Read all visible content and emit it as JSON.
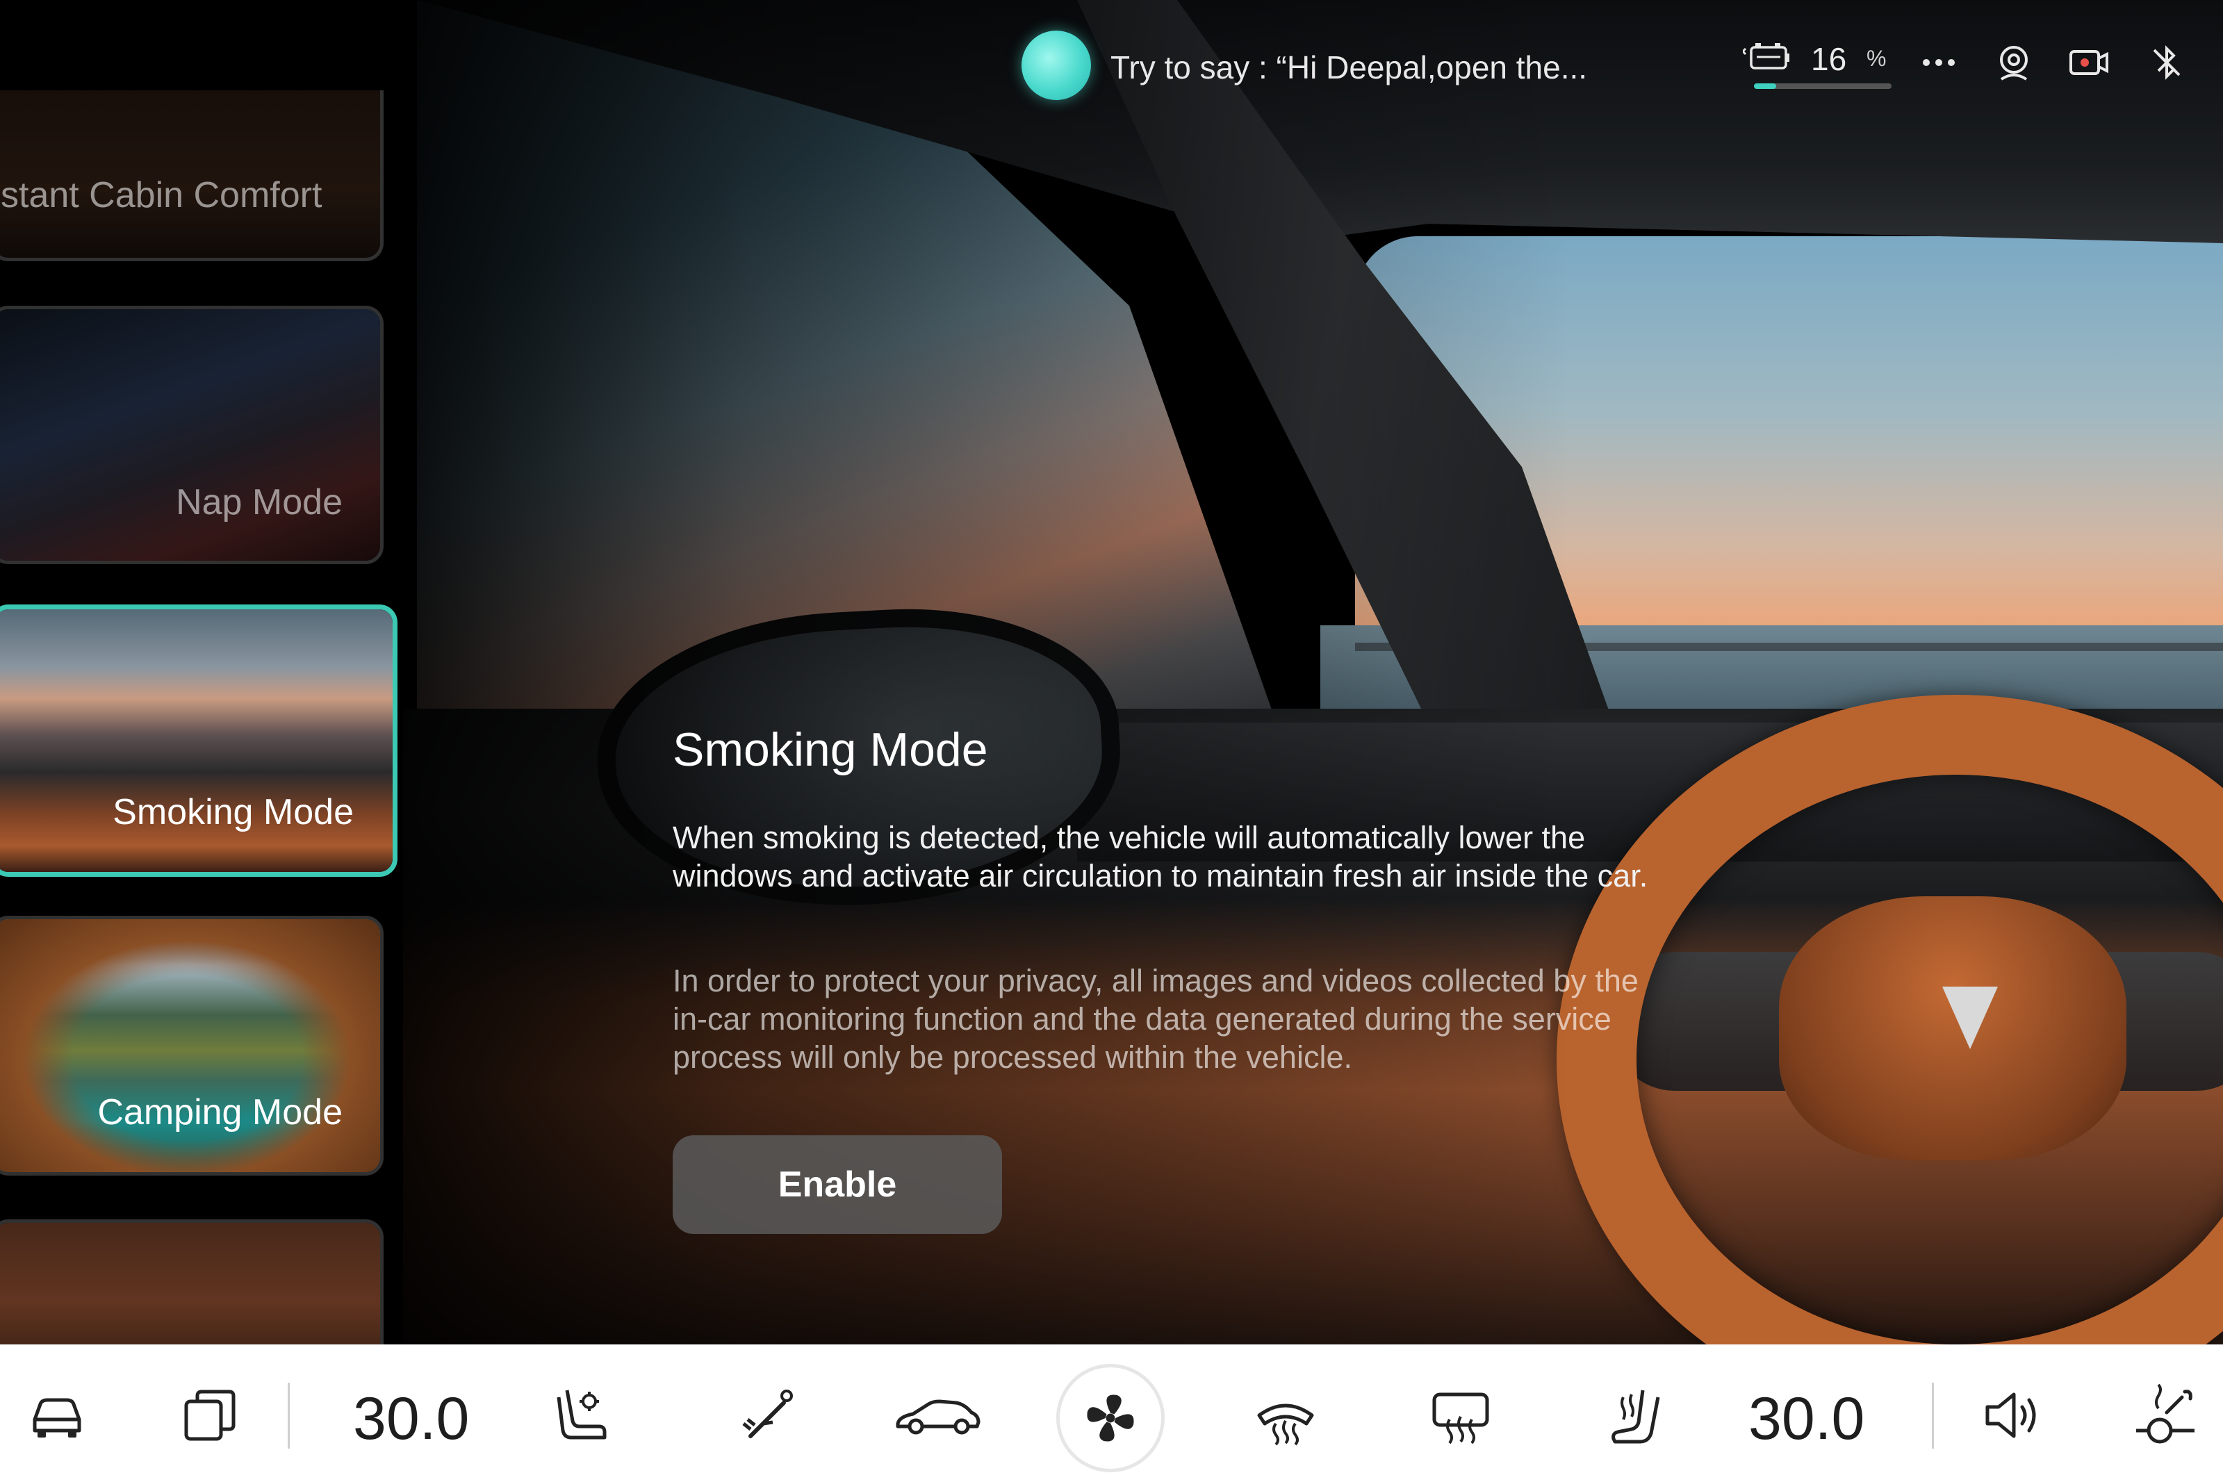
{
  "status_bar": {
    "voice_hint": "Try to say : “Hi Deepal,open the...",
    "battery_value": "16",
    "battery_unit": "%",
    "battery_fraction": 0.16,
    "icons": [
      "battery-icon",
      "more-icon",
      "camera-user-icon",
      "record-icon",
      "bluetooth-off-icon"
    ]
  },
  "sidebar": {
    "items": [
      {
        "label": "stant Cabin Comfort",
        "selected": false
      },
      {
        "label": "Nap Mode",
        "selected": false
      },
      {
        "label": "Smoking Mode",
        "selected": true
      },
      {
        "label": "Camping Mode",
        "selected": false
      },
      {
        "label": "",
        "selected": false
      }
    ]
  },
  "detail": {
    "title": "Smoking Mode",
    "description": "When smoking is detected, the vehicle will automatically lower the windows and activate air circulation to maintain fresh air inside the car.",
    "privacy_note": "In order to protect your privacy, all images and videos collected by the in-car monitoring function and the data generated during the service process will only be processed within the vehicle.",
    "enable_label": "Enable"
  },
  "dock": {
    "left_temp": "30.0",
    "right_temp": "30.0",
    "icons": [
      "car-icon",
      "multi-window-icon",
      "seat-ventilation-icon",
      "wiper-icon",
      "car-profile-icon",
      "fan-icon",
      "front-defrost-icon",
      "rear-defrost-icon",
      "seat-heat-icon",
      "volume-icon",
      "steering-heat-icon"
    ]
  },
  "colors": {
    "accent": "#3cc9b4",
    "voice_orb": "#49d9cc",
    "button_bg": "#5a5a5a",
    "dock_bg": "#ffffff"
  }
}
